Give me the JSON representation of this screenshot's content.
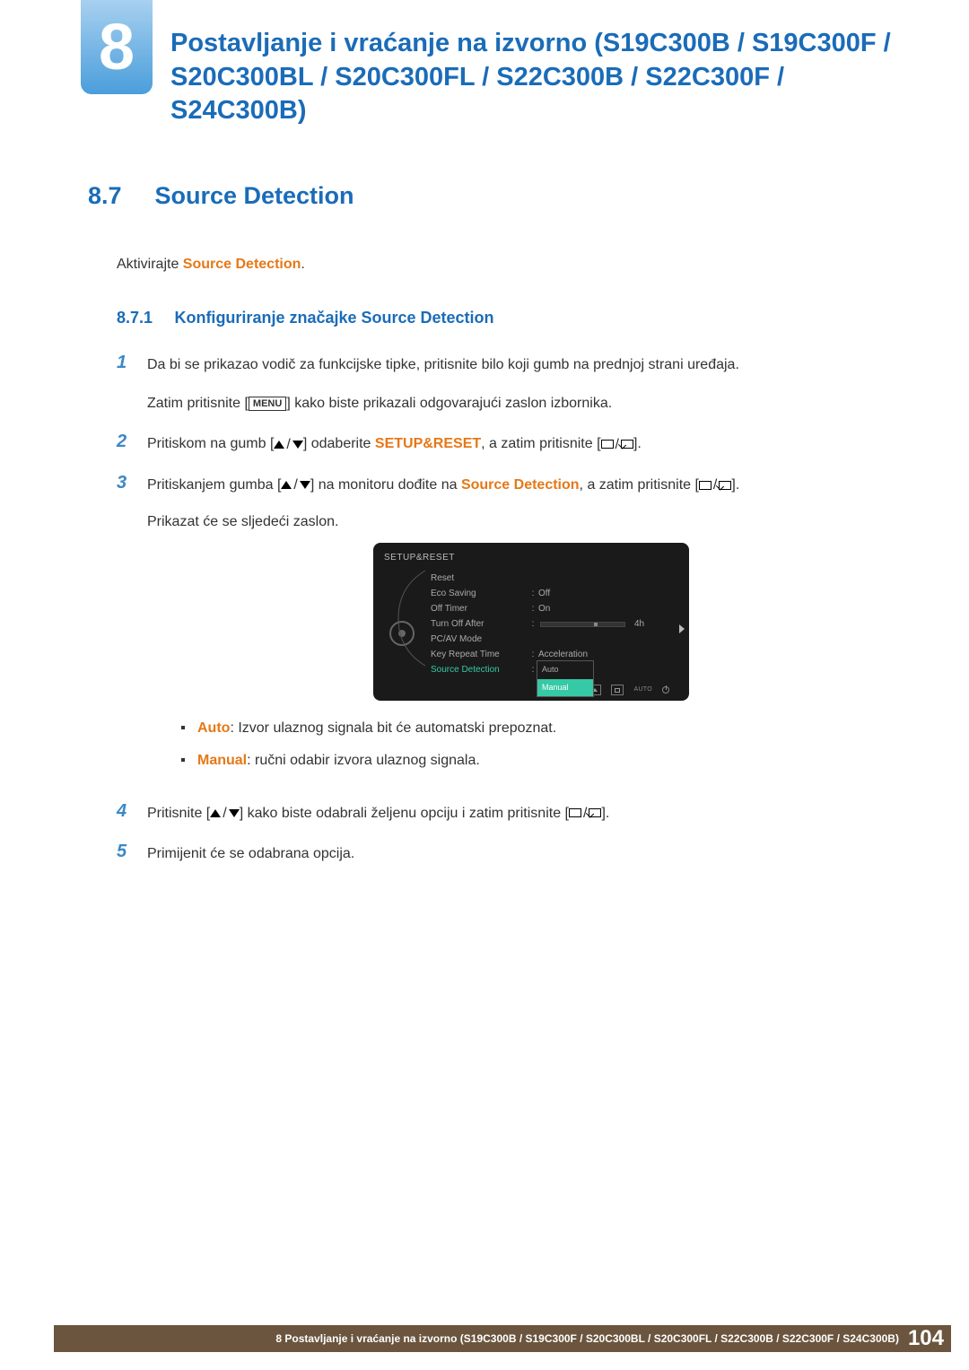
{
  "chapter": {
    "number": "8",
    "title": "Postavljanje i vraćanje na izvorno (S19C300B / S19C300F / S20C300BL / S20C300FL / S22C300B / S22C300F / S24C300B)"
  },
  "section": {
    "number": "8.7",
    "title": "Source Detection"
  },
  "intro": {
    "prefix": "Aktivirajte ",
    "highlight": "Source Detection",
    "suffix": "."
  },
  "subsection": {
    "number": "8.7.1",
    "title": "Konfiguriranje značajke Source Detection"
  },
  "steps": {
    "s1": {
      "num": "1",
      "line1": "Da bi se prikazao vodič za funkcijske tipke, pritisnite bilo koji gumb na prednjoj strani uređaja.",
      "line2a": "Zatim pritisnite [",
      "menu": "MENU",
      "line2b": "] kako biste prikazali odgovarajući zaslon izbornika."
    },
    "s2": {
      "num": "2",
      "a": "Pritiskom na gumb [",
      "b": "] odaberite ",
      "hl": "SETUP&RESET",
      "c": ", a zatim pritisnite [",
      "d": "]."
    },
    "s3": {
      "num": "3",
      "a": "Pritiskanjem gumba [",
      "b": "] na monitoru dođite na ",
      "hl": "Source Detection",
      "c": ", a zatim pritisnite [",
      "d": "].",
      "e": "Prikazat će se sljedeći zaslon."
    },
    "s4": {
      "num": "4",
      "a": "Pritisnite [",
      "b": "] kako biste odabrali željenu opciju i zatim pritisnite [",
      "c": "]."
    },
    "s5": {
      "num": "5",
      "text": "Primijenit će se odabrana opcija."
    }
  },
  "osd": {
    "header": "SETUP&RESET",
    "rows": {
      "reset": "Reset",
      "eco": "Eco Saving",
      "eco_val": "Off",
      "offtimer": "Off Timer",
      "offtimer_val": "On",
      "turnoff": "Turn Off After",
      "turnoff_val": "4h",
      "pcav": "PC/AV Mode",
      "keyrep": "Key Repeat Time",
      "keyrep_val": "Acceleration",
      "src": "Source Detection"
    },
    "dropdown": {
      "auto": "Auto",
      "manual": "Manual"
    },
    "auto_btn": "AUTO"
  },
  "bullets": {
    "auto": {
      "label": "Auto",
      "text": ": Izvor ulaznog signala bit će automatski prepoznat."
    },
    "manual": {
      "label": "Manual",
      "text": ": ručni odabir izvora ulaznog signala."
    }
  },
  "footer": {
    "text": "8 Postavljanje i vraćanje na izvorno (S19C300B / S19C300F / S20C300BL / S20C300FL / S22C300B / S22C300F / S24C300B)",
    "page": "104"
  }
}
